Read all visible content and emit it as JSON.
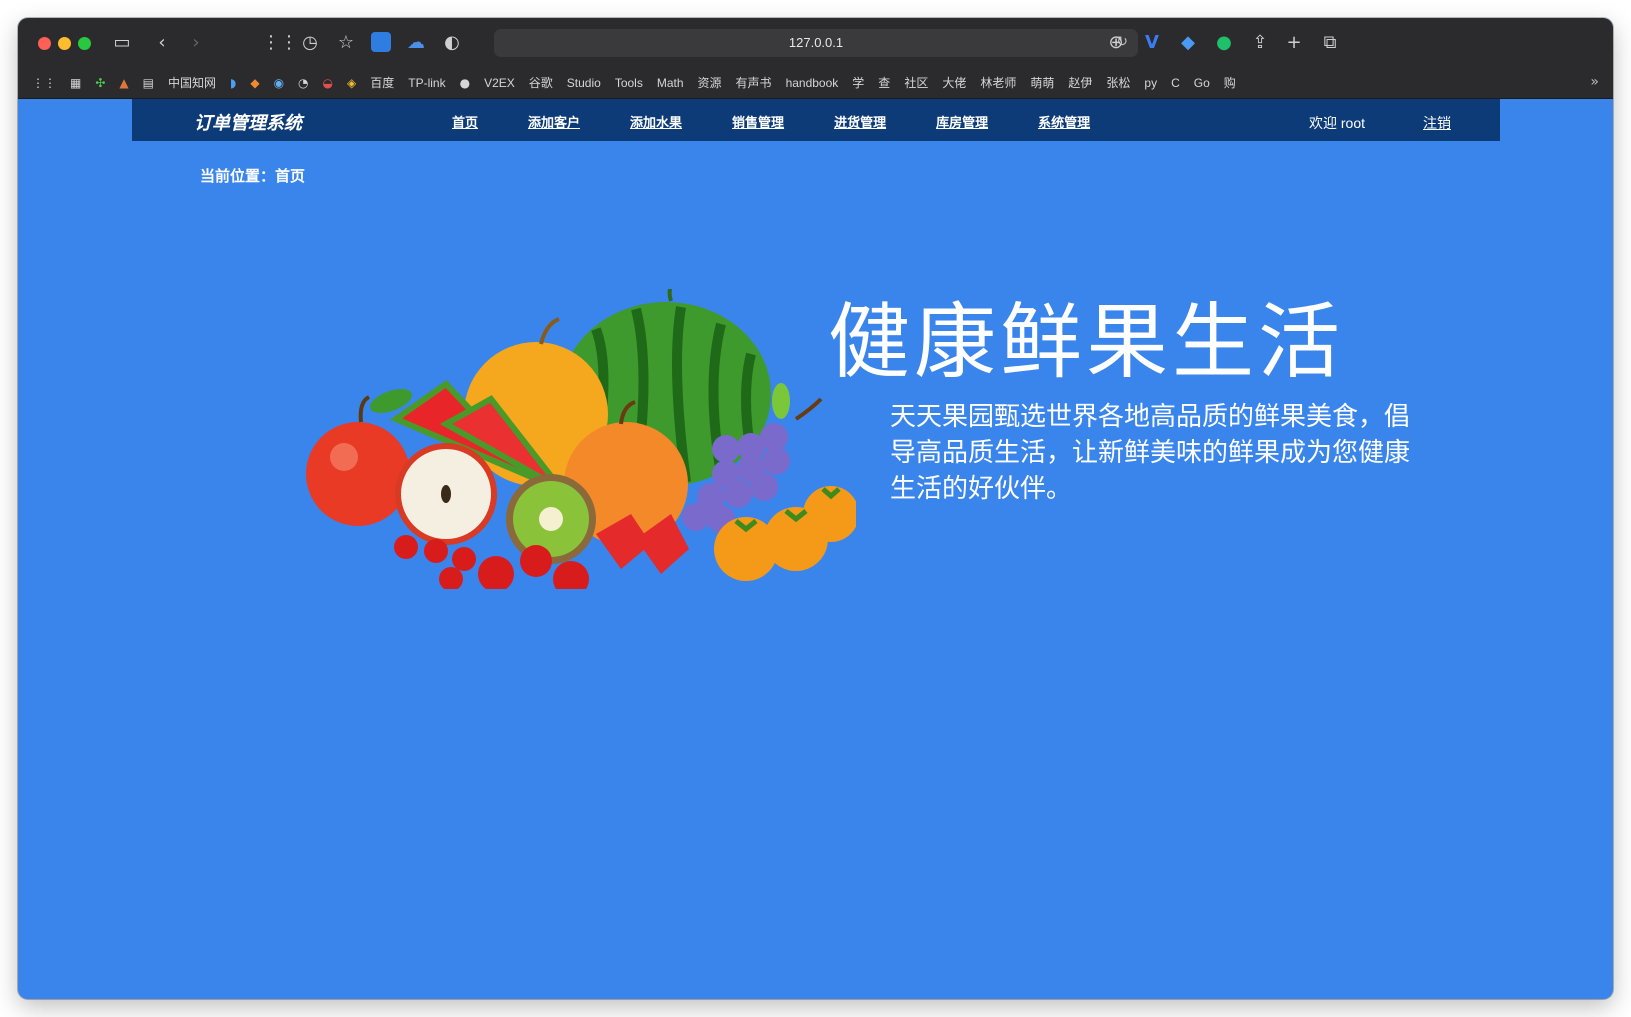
{
  "browser": {
    "url": "127.0.0.1",
    "bookmarks": [
      "中国知网",
      "百度",
      "TP-link",
      "V2EX",
      "谷歌",
      "Studio",
      "Tools",
      "Math",
      "资源",
      "有声书",
      "handbook",
      "学",
      "查",
      "社区",
      "大佬",
      "林老师",
      "萌萌",
      "赵伊",
      "张松",
      "py",
      "C",
      "Go",
      "购"
    ]
  },
  "navbar": {
    "brand": "订单管理系统",
    "links": [
      "首页",
      "添加客户",
      "添加水果",
      "销售管理",
      "进货管理",
      "库房管理",
      "系统管理"
    ],
    "welcome": "欢迎 root",
    "logout": "注销"
  },
  "breadcrumb": "当前位置：首页",
  "hero": {
    "headline": "健康鲜果生活",
    "slogan": "天天果园甄选世界各地高品质的鲜果美食，倡导高品质生活，让新鲜美味的鲜果成为您健康生活的好伙伴。"
  },
  "colors": {
    "page_bg": "#3a85ec",
    "navbar_bg": "#0d3b78",
    "chrome_bg": "#2b2b2d"
  }
}
